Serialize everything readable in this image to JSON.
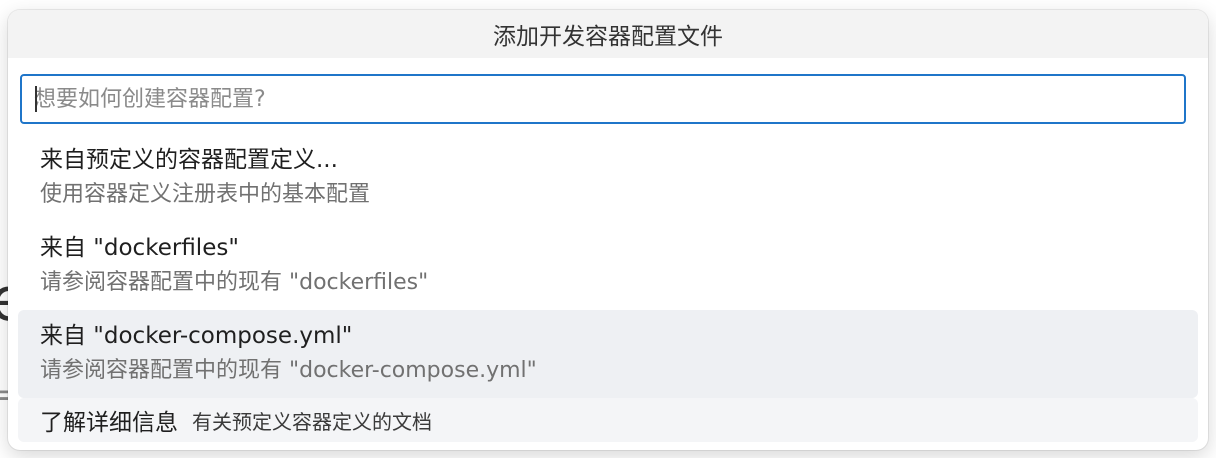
{
  "quick_pick": {
    "title": "添加开发容器配置文件",
    "input": {
      "value": "",
      "placeholder": "想要如何创建容器配置?"
    },
    "items": [
      {
        "label": "来自预定义的容器配置定义...",
        "detail": "使用容器定义注册表中的基本配置"
      },
      {
        "label": "来自 \"dockerfiles\"",
        "detail": "请参阅容器配置中的现有 \"dockerfiles\""
      },
      {
        "label": "来自 \"docker-compose.yml\"",
        "detail": "请参阅容器配置中的现有 \"docker-compose.yml\""
      }
    ],
    "learn_more": {
      "label": "了解详细信息",
      "description": "有关预定义容器定义的文档"
    }
  },
  "background": {
    "fragment_a": "e",
    "fragment_b": "="
  },
  "colors": {
    "accent": "#1f75c9",
    "title_bar_bg": "#f3f3f3",
    "active_item_bg": "#eef0f3"
  }
}
